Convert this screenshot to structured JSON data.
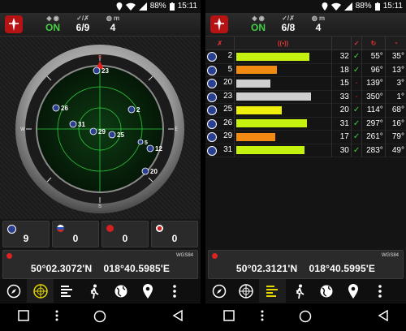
{
  "status_bar": {
    "battery": "88%",
    "time": "15:11"
  },
  "left": {
    "header": {
      "fix_status": "ON",
      "sats": "6/9",
      "satellites_used": "4"
    },
    "radar": {
      "directions": [
        "N",
        "E",
        "S",
        "W"
      ],
      "satellites": [
        {
          "prn": "23",
          "active": true
        },
        {
          "prn": "2",
          "active": true
        },
        {
          "prn": "26",
          "active": true
        },
        {
          "prn": "31",
          "active": true
        },
        {
          "prn": "29",
          "active": true
        },
        {
          "prn": "25",
          "active": true
        },
        {
          "prn": "12",
          "active": true
        },
        {
          "prn": "20",
          "active": true
        },
        {
          "prn": "5",
          "active": true
        }
      ]
    },
    "constellations": [
      {
        "name": "GPS",
        "count": "9"
      },
      {
        "name": "GLONASS",
        "count": "0"
      },
      {
        "name": "Galileo",
        "count": "0"
      },
      {
        "name": "BeiDou",
        "count": "0"
      }
    ],
    "position": {
      "datum": "WGS84",
      "latlon": "50°02.3072'N    018°40.5985'E"
    }
  },
  "right": {
    "header": {
      "fix_status": "ON",
      "sats": "6/8",
      "satellites_used": "4"
    },
    "table": {
      "rows": [
        {
          "prn": "2",
          "snr": 32,
          "snr_text": "32",
          "used": "✓",
          "azimuth": "55°",
          "elevation": "35°",
          "color": "#c6f20f"
        },
        {
          "prn": "5",
          "snr": 18,
          "snr_text": "18",
          "used": "✓",
          "azimuth": "96°",
          "elevation": "13°",
          "color": "#f08a12"
        },
        {
          "prn": "20",
          "snr": 15,
          "snr_text": "15",
          "used": "-",
          "azimuth": "139°",
          "elevation": "3°",
          "color": "#cfcfcf"
        },
        {
          "prn": "23",
          "snr": 33,
          "snr_text": "33",
          "used": "-",
          "azimuth": "350°",
          "elevation": "1°",
          "color": "#cfcfcf"
        },
        {
          "prn": "25",
          "snr": 20,
          "snr_text": "20",
          "used": "✓",
          "azimuth": "114°",
          "elevation": "68°",
          "color": "#eef00c"
        },
        {
          "prn": "26",
          "snr": 31,
          "snr_text": "31",
          "used": "✓",
          "azimuth": "297°",
          "elevation": "16°",
          "color": "#c6f20f"
        },
        {
          "prn": "29",
          "snr": 17,
          "snr_text": "17",
          "used": "✓",
          "azimuth": "261°",
          "elevation": "79°",
          "color": "#f08a12"
        },
        {
          "prn": "31",
          "snr": 30,
          "snr_text": "30",
          "used": "✓",
          "azimuth": "283°",
          "elevation": "49°",
          "color": "#c6f20f"
        }
      ]
    },
    "position": {
      "datum": "WGS84",
      "latlon": "50°02.3121'N    018°40.5995'E"
    }
  },
  "toolbar": [
    "compass-icon",
    "radar-icon",
    "signal-bars-icon",
    "walking-icon",
    "globe-icon",
    "location-pin-icon",
    "more-icon"
  ],
  "colors": {
    "accent_green": "#43d143",
    "alert_red": "#d32020",
    "flag_blue": "#2a3f8f"
  }
}
